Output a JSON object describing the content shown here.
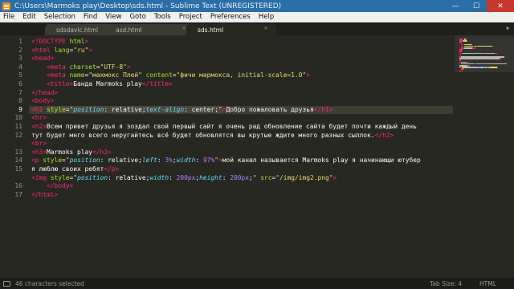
{
  "window": {
    "title": "C:\\Users\\Marmoks play\\Desktop\\sds.html - Sublime Text (UNREGISTERED)",
    "minimize": "—",
    "maximize": "☐",
    "close": "✕"
  },
  "menu": [
    "File",
    "Edit",
    "Selection",
    "Find",
    "View",
    "Goto",
    "Tools",
    "Project",
    "Preferences",
    "Help"
  ],
  "tabs": [
    {
      "label": "sdsdavic.html",
      "active": false
    },
    {
      "label": "asd.html",
      "active": false
    },
    {
      "label": "sds.html",
      "active": true
    }
  ],
  "tab_close_glyph": "×",
  "tab_dropdown_glyph": "▾",
  "editor": {
    "current_line": 9,
    "line_numbers": [
      "1",
      "2",
      "3",
      "4",
      "5",
      "6",
      "7",
      "8",
      "9",
      "10",
      "11",
      "12",
      "",
      "13",
      "14",
      "15",
      "",
      "16",
      "17"
    ]
  },
  "status": {
    "left": "46 characters selected",
    "tab_size": "Tab Size: 4",
    "syntax": "HTML"
  },
  "colors": {
    "background": "#272822",
    "tag": "#f92672",
    "attribute": "#a6e22e",
    "string": "#e6db74",
    "css_property": "#66d9ef",
    "number": "#ae81ff",
    "titlebar": "#2a6ea8"
  },
  "code_lines": [
    [
      [
        "t",
        "<!DOCTYPE"
      ],
      [
        "p",
        " "
      ],
      [
        "a",
        "html"
      ],
      [
        "t",
        ">"
      ]
    ],
    [
      [
        "t",
        "<html"
      ],
      [
        "p",
        " "
      ],
      [
        "a",
        "lang"
      ],
      [
        "p",
        "="
      ],
      [
        "s",
        "\"ru\""
      ],
      [
        "t",
        ">"
      ]
    ],
    [
      [
        "t",
        "<head>"
      ]
    ],
    [
      [
        "p",
        "    "
      ],
      [
        "t",
        "<meta"
      ],
      [
        "p",
        " "
      ],
      [
        "a",
        "charset"
      ],
      [
        "p",
        "="
      ],
      [
        "s",
        "\"UTF-8\""
      ],
      [
        "t",
        ">"
      ]
    ],
    [
      [
        "p",
        "    "
      ],
      [
        "t",
        "<meta"
      ],
      [
        "p",
        " "
      ],
      [
        "a",
        "name"
      ],
      [
        "p",
        "="
      ],
      [
        "s",
        "\"макмокс Плей\""
      ],
      [
        "p",
        " "
      ],
      [
        "a",
        "content"
      ],
      [
        "p",
        "="
      ],
      [
        "s",
        "\"фичи мармокса, initial-scale=1.0\""
      ],
      [
        "t",
        ">"
      ]
    ],
    [
      [
        "p",
        "    "
      ],
      [
        "t",
        "<title>"
      ],
      [
        "p",
        "Банда Marmoks play"
      ],
      [
        "t",
        "</title>"
      ]
    ],
    [
      [
        "t",
        "</head>"
      ]
    ],
    [
      [
        "t",
        "<body>"
      ]
    ],
    [
      [
        "t",
        "<h1"
      ],
      [
        "p",
        " "
      ],
      [
        "a",
        "style"
      ],
      [
        "p",
        "="
      ],
      [
        "s",
        "\""
      ],
      [
        "c",
        "position"
      ],
      [
        "p",
        ":"
      ],
      [
        "p",
        " relative;"
      ],
      [
        "c",
        "text-align"
      ],
      [
        "p",
        ":"
      ],
      [
        "p",
        " center;"
      ],
      [
        "s",
        "\""
      ],
      [
        "t",
        ">"
      ],
      [
        "p",
        "Добро пожаловать друзья"
      ],
      [
        "t",
        "</h1>"
      ]
    ],
    [
      [
        "t",
        "<hr>"
      ]
    ],
    [
      [
        "t",
        "<h2>"
      ],
      [
        "p",
        "Всем привет друзья я зоздал свой первый сайт я очень рад обновление сайта будет почти каждый день"
      ]
    ],
    [
      [
        "p",
        "тут будет мнго всего неругайтесь всё будет обновлятся вы крутые ждите много разных сыллок."
      ],
      [
        "t",
        "</h2>"
      ]
    ],
    [
      [
        "t",
        "<br>"
      ]
    ],
    [
      [
        "t",
        "<h3>"
      ],
      [
        "p",
        "Marmoks play"
      ],
      [
        "t",
        "</h3>"
      ]
    ],
    [
      [
        "t",
        "<p"
      ],
      [
        "p",
        " "
      ],
      [
        "a",
        "style"
      ],
      [
        "p",
        "="
      ],
      [
        "s",
        "\""
      ],
      [
        "c",
        "position"
      ],
      [
        "p",
        ": relative;"
      ],
      [
        "c",
        "left"
      ],
      [
        "p",
        ": "
      ],
      [
        "n",
        "3%"
      ],
      [
        "p",
        ";"
      ],
      [
        "c",
        "width"
      ],
      [
        "p",
        ": "
      ],
      [
        "n",
        "97%"
      ],
      [
        "s",
        "\""
      ],
      [
        "t",
        ">"
      ],
      [
        "p",
        "мой канал называется Marmoks play я начинающи ютубер"
      ]
    ],
    [
      [
        "p",
        "я люблю своих ребят"
      ],
      [
        "t",
        "</p>"
      ]
    ],
    [
      [
        "t",
        "<img"
      ],
      [
        "p",
        " "
      ],
      [
        "a",
        "style"
      ],
      [
        "p",
        "="
      ],
      [
        "s",
        "\""
      ],
      [
        "c",
        "position"
      ],
      [
        "p",
        ": relative;"
      ],
      [
        "c",
        "width"
      ],
      [
        "p",
        ": "
      ],
      [
        "n",
        "200px"
      ],
      [
        "p",
        ";"
      ],
      [
        "c",
        "height"
      ],
      [
        "p",
        ": "
      ],
      [
        "n",
        "200px"
      ],
      [
        "p",
        ";"
      ],
      [
        "s",
        "\""
      ],
      [
        "p",
        " "
      ],
      [
        "a",
        "src"
      ],
      [
        "p",
        "="
      ],
      [
        "s",
        "\"/img/img2.png\""
      ],
      [
        "t",
        ">"
      ]
    ],
    [
      [
        "p",
        "    "
      ],
      [
        "t",
        "</body>"
      ]
    ],
    [
      [
        "t",
        "</html>"
      ]
    ]
  ]
}
